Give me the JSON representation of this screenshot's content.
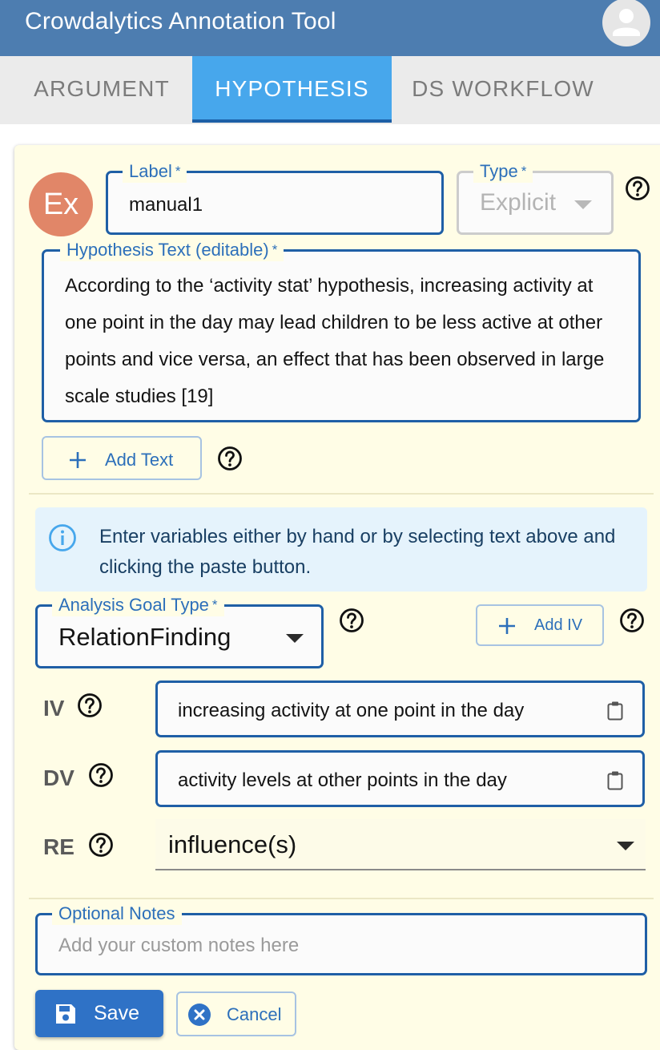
{
  "app": {
    "title": "Crowdalytics Annotation Tool",
    "avatar_icon": "account-circle-icon"
  },
  "tabs": [
    {
      "label": "ARGUMENT",
      "active": false
    },
    {
      "label": "HYPOTHESIS",
      "active": true
    },
    {
      "label": "DS WORKFLOW",
      "active": false
    }
  ],
  "badge": {
    "text": "Ex",
    "color": "#e18668"
  },
  "label_field": {
    "legend": "Label",
    "required": "*",
    "value": "manual1"
  },
  "type_field": {
    "legend": "Type",
    "required": "*",
    "value": "Explicit"
  },
  "hypothesis_field": {
    "legend": "Hypothesis Text (editable)",
    "required": "*",
    "value": "According to the ‘activity stat’ hypothesis, increasing activity at one point in the day may lead children to be less active at other points and vice versa, an effect that has been observed in large scale studies [19]"
  },
  "add_text_button": {
    "label": "Add Text"
  },
  "info": {
    "text": "Enter variables either by hand or by selecting text above and clicking the paste button."
  },
  "analysis_goal": {
    "legend": "Analysis Goal Type",
    "required": "*",
    "value": "RelationFinding"
  },
  "add_iv_button": {
    "label": "Add IV"
  },
  "variables": {
    "iv": {
      "label": "IV",
      "value": "increasing activity at one point in the day"
    },
    "dv": {
      "label": "DV",
      "value": "activity levels at other points in the day"
    },
    "re": {
      "label": "RE",
      "value": "influence(s)"
    }
  },
  "notes": {
    "legend": "Optional Notes",
    "placeholder": "Add your custom notes here"
  },
  "actions": {
    "save_label": "Save",
    "cancel_label": "Cancel"
  },
  "colors": {
    "appbar": "#4d7db0",
    "active_tab": "#47a7ec",
    "primary": "#1f5fa6",
    "card": "#fffde6"
  }
}
